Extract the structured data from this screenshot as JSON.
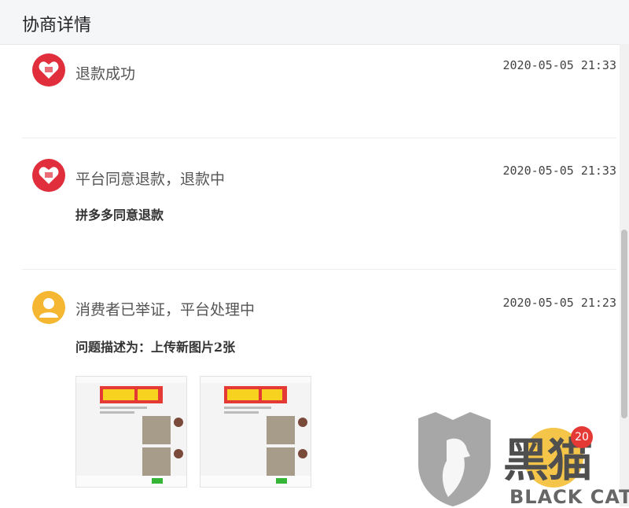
{
  "header": {
    "title": "协商详情"
  },
  "entries": [
    {
      "event": "退款成功",
      "time": "2020-05-05 21:33",
      "actor": "pinduoduo-logo"
    },
    {
      "event": "平台同意退款，退款中",
      "time": "2020-05-05 21:33",
      "actor": "pinduoduo-logo",
      "detail": "拼多多同意退款"
    },
    {
      "event": "消费者已举证，平台处理中",
      "time": "2020-05-05 21:23",
      "actor": "user-avatar",
      "detail": "问题描述为：上传新图片2张"
    }
  ],
  "watermark": {
    "brand_en": "BLACK CAT",
    "brand_cn": "黑猫",
    "badge": "20"
  },
  "colors": {
    "pdd_red": "#e02e3c",
    "user_yellow": "#f5b731",
    "header_bg": "#f5f6f8"
  }
}
